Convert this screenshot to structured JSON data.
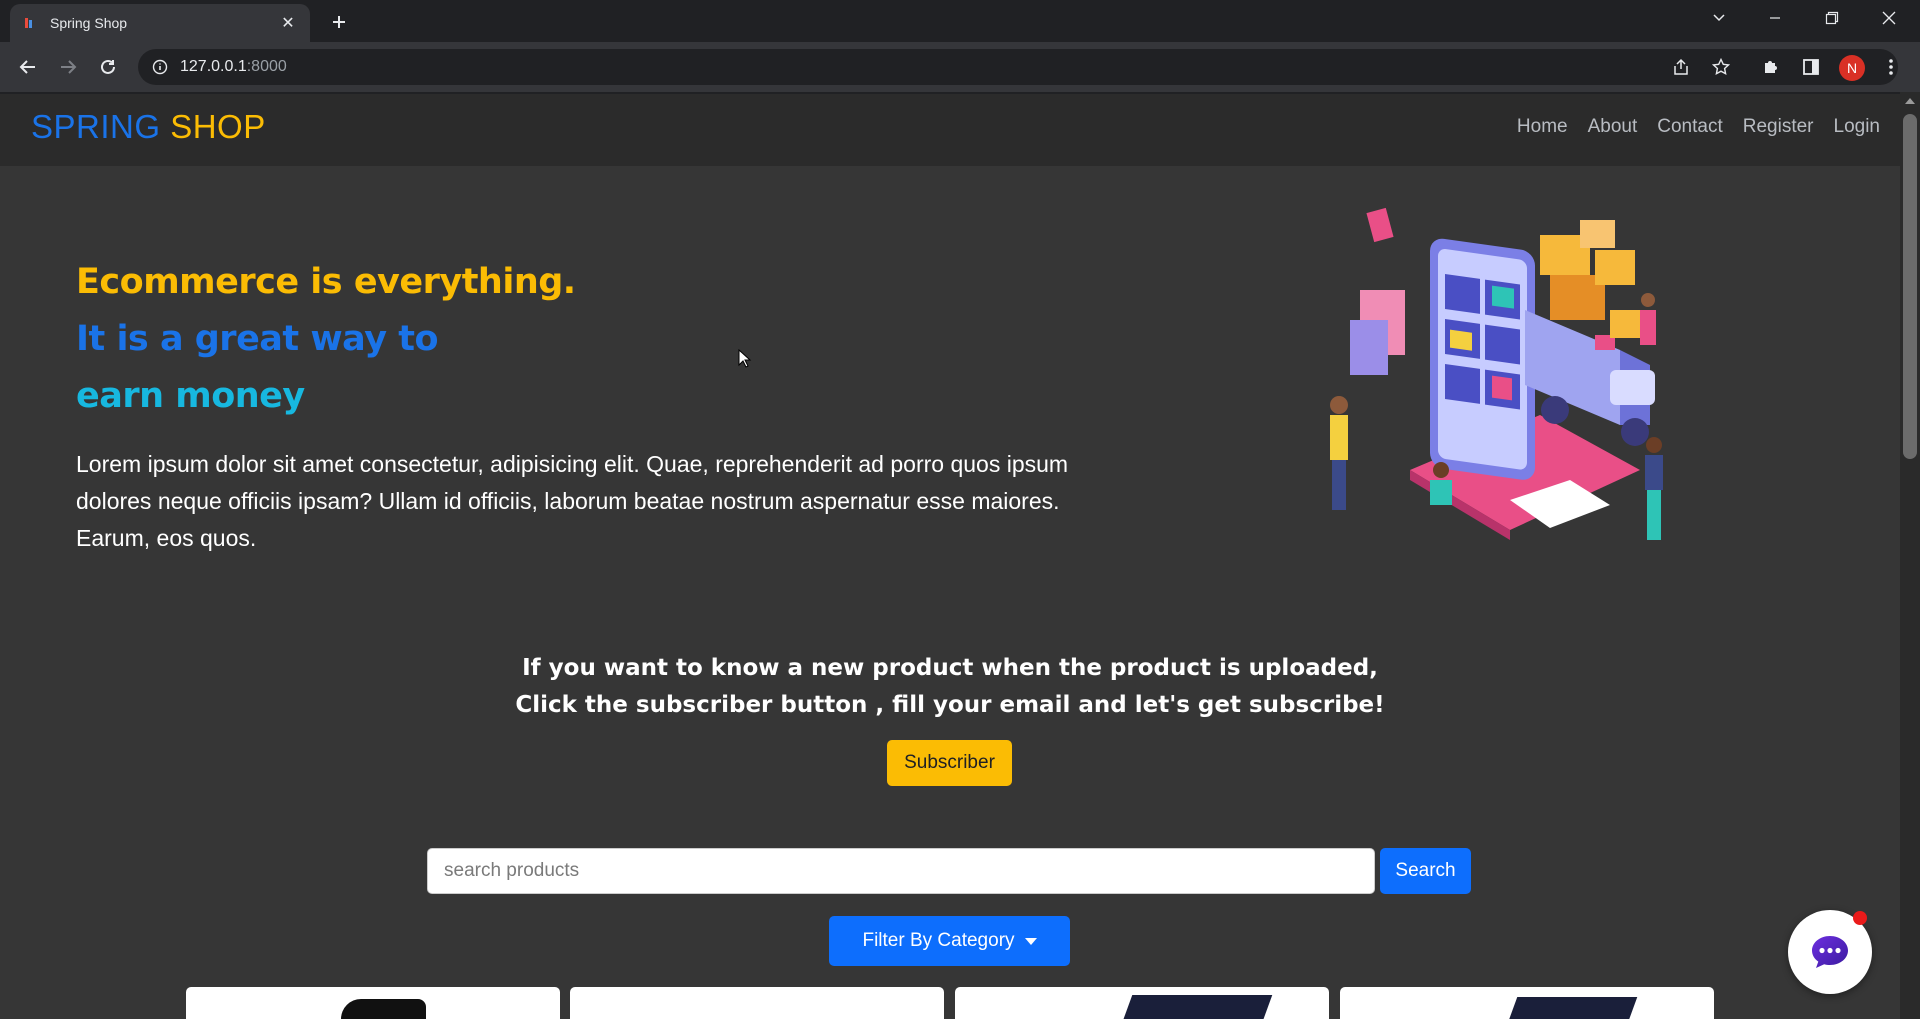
{
  "browser": {
    "tab_title": "Spring Shop",
    "url_host": "127.0.0.1",
    "url_port": ":8000",
    "profile_initial": "N"
  },
  "site": {
    "brand_part1": "SPRING",
    "brand_part2": "SHOP",
    "nav": [
      "Home",
      "About",
      "Contact",
      "Register",
      "Login"
    ]
  },
  "hero": {
    "line1": "Ecommerce is everything.",
    "line2": "It is a great way to",
    "line3": "earn money",
    "paragraph": "Lorem ipsum dolor sit amet consectetur, adipisicing elit. Quae, reprehenderit ad porro quos ipsum dolores neque officiis ipsam? Ullam id officiis, laborum beatae nostrum aspernatur esse maiores. Earum, eos quos."
  },
  "subscribe": {
    "text_line1": "If you want to know a new product when the product is uploaded,",
    "text_line2": "Click the subscriber button , fill your email and let's get subscribe!",
    "button_label": "Subscriber"
  },
  "search": {
    "placeholder": "search products",
    "button_label": "Search"
  },
  "filter": {
    "button_label": "Filter By Category"
  },
  "colors": {
    "brand_blue": "#1a73e8",
    "brand_yellow": "#fbbc04",
    "accent_cyan": "#17b8e0",
    "primary_button": "#0d6efd",
    "page_bg": "#363636"
  }
}
